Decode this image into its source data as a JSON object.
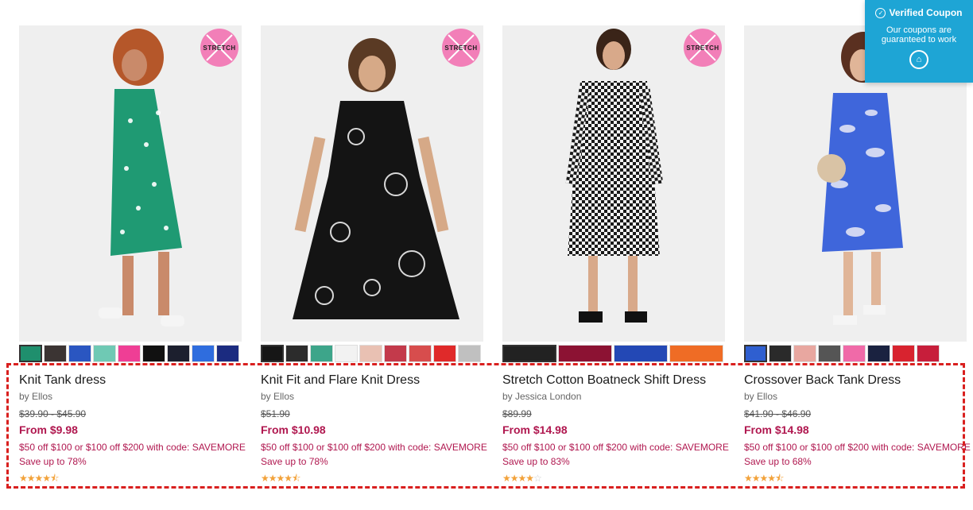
{
  "products": [
    {
      "title": "Knit Tank dress",
      "brand": "by Ellos",
      "original_price": "$39.90 - $45.90",
      "sale_price": "From $9.98",
      "promo": "$50 off $100 or $100 off $200 with code: SAVEMORE",
      "save": "Save up to 78%",
      "rating": 4.5,
      "badge": "STRETCH",
      "swatches": [
        "#1f8f6d",
        "#3b3433",
        "#2a56c1",
        "#6fc9b4",
        "#ef3e95",
        "#111111",
        "#1c1f2e",
        "#2f6dde",
        "#1b2b80"
      ]
    },
    {
      "title": "Knit Fit and Flare Knit Dress",
      "brand": "by Ellos",
      "original_price": "$51.90",
      "sale_price": "From $10.98",
      "promo": "$50 off $100 or $100 off $200 with code: SAVEMORE",
      "save": "Save up to 78%",
      "rating": 4.5,
      "badge": "STRETCH",
      "swatches": [
        "#161616",
        "#2c2c2c",
        "#3da58a",
        "#f2f2f2",
        "#e9c1b3",
        "#c33a4b",
        "#d74d4d",
        "#e02a2a",
        "#c0c0c0"
      ]
    },
    {
      "title": "Stretch Cotton Boatneck Shift Dress",
      "brand": "by Jessica London",
      "original_price": "$89.99",
      "sale_price": "From $14.98",
      "promo": "$50 off $100 or $100 off $200 with code: SAVEMORE",
      "save": "Save up to 83%",
      "rating": 4,
      "badge": "STRETCH",
      "swatches": [
        "#222222",
        "#8c1233",
        "#2348b5",
        "#ef6c25"
      ]
    },
    {
      "title": "Crossover Back Tank Dress",
      "brand": "by Ellos",
      "original_price": "$41.90 - $46.90",
      "sale_price": "From $14.98",
      "promo": "$50 off $100 or $100 off $200 with code: SAVEMORE",
      "save": "Save up to 68%",
      "rating": 4.5,
      "badge": "",
      "swatches": [
        "#2f5fd0",
        "#2a2a2a",
        "#e8a7a0",
        "#555555",
        "#f06aa8",
        "#1a2240",
        "#d8232f",
        "#c71e3b"
      ]
    }
  ],
  "coupon": {
    "title": "Verified Coupon",
    "subtitle": "Our coupons are guaranteed to work"
  },
  "colors": {
    "accent": "#b0174f",
    "highlight_box": "#d9201f",
    "coupon_bg": "#1ea5d5"
  }
}
